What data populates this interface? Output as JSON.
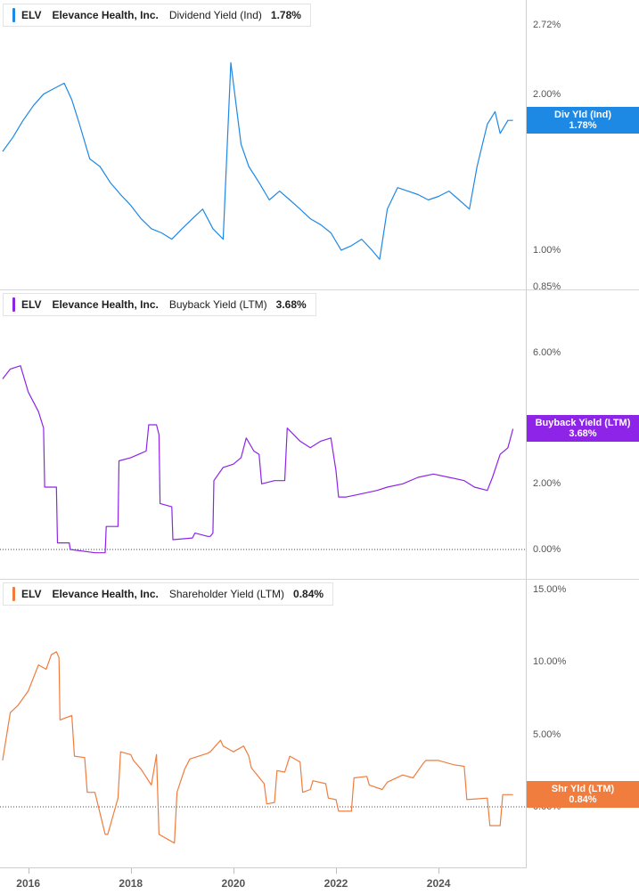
{
  "chart_data": [
    {
      "type": "line",
      "ticker": "ELV",
      "company": "Elevance Health, Inc.",
      "metric": "Dividend Yield (Ind)",
      "current_value": "1.78%",
      "tag_label": "Div Yld (Ind)",
      "tag_value": "1.78%",
      "color": "#1e88e5",
      "yscale": "log",
      "ylim": [
        0.85,
        2.72
      ],
      "yticks": [
        {
          "value": 2.72,
          "label": "2.72%"
        },
        {
          "value": 2.0,
          "label": "2.00%"
        },
        {
          "value": 1.0,
          "label": "1.00%"
        },
        {
          "value": 0.85,
          "label": "0.85%"
        }
      ],
      "series": [
        {
          "x": [
            2015.5,
            2015.7,
            2015.9,
            2016.1,
            2016.3,
            2016.5,
            2016.7,
            2016.85,
            2017.0,
            2017.2,
            2017.4,
            2017.6,
            2017.8,
            2018.0,
            2018.2,
            2018.4,
            2018.6,
            2018.8,
            2019.0,
            2019.2,
            2019.4,
            2019.6,
            2019.8,
            2019.95,
            2020.15,
            2020.3,
            2020.5,
            2020.7,
            2020.9,
            2021.1,
            2021.3,
            2021.5,
            2021.7,
            2021.9,
            2022.1,
            2022.3,
            2022.5,
            2022.7,
            2022.85,
            2023.0,
            2023.2,
            2023.4,
            2023.6,
            2023.8,
            2024.0,
            2024.2,
            2024.4,
            2024.6,
            2024.75,
            2024.95,
            2025.1,
            2025.2,
            2025.35,
            2025.45
          ],
          "y": [
            1.55,
            1.65,
            1.78,
            1.9,
            2.0,
            2.05,
            2.1,
            1.95,
            1.75,
            1.5,
            1.45,
            1.35,
            1.28,
            1.22,
            1.15,
            1.1,
            1.08,
            1.05,
            1.1,
            1.15,
            1.2,
            1.1,
            1.05,
            2.3,
            1.6,
            1.45,
            1.35,
            1.25,
            1.3,
            1.25,
            1.2,
            1.15,
            1.12,
            1.08,
            1.0,
            1.02,
            1.05,
            1.0,
            0.96,
            1.2,
            1.32,
            1.3,
            1.28,
            1.25,
            1.27,
            1.3,
            1.25,
            1.2,
            1.45,
            1.75,
            1.85,
            1.68,
            1.78,
            1.78
          ]
        }
      ]
    },
    {
      "type": "line",
      "ticker": "ELV",
      "company": "Elevance Health, Inc.",
      "metric": "Buyback Yield (LTM)",
      "current_value": "3.68%",
      "tag_label": "Buyback Yield (LTM)",
      "tag_value": "3.68%",
      "color": "#8e24e8",
      "yscale": "linear",
      "ylim": [
        0,
        6
      ],
      "yticks": [
        {
          "value": 6.0,
          "label": "6.00%"
        },
        {
          "value": 2.0,
          "label": "2.00%"
        },
        {
          "value": 0.0,
          "label": "0.00%"
        }
      ],
      "series": [
        {
          "x": [
            2015.5,
            2015.65,
            2015.85,
            2016.0,
            2016.2,
            2016.3,
            2016.32,
            2016.55,
            2016.57,
            2016.8,
            2016.82,
            2017.3,
            2017.5,
            2017.52,
            2017.75,
            2017.77,
            2018.0,
            2018.3,
            2018.35,
            2018.5,
            2018.55,
            2018.57,
            2018.8,
            2018.82,
            2019.2,
            2019.25,
            2019.5,
            2019.55,
            2019.6,
            2019.62,
            2019.8,
            2020.0,
            2020.15,
            2020.25,
            2020.4,
            2020.5,
            2020.55,
            2020.8,
            2021.0,
            2021.05,
            2021.3,
            2021.5,
            2021.7,
            2021.9,
            2022.0,
            2022.05,
            2022.2,
            2022.5,
            2022.8,
            2023.0,
            2023.3,
            2023.6,
            2023.9,
            2024.2,
            2024.5,
            2024.7,
            2024.95,
            2025.05,
            2025.2,
            2025.35,
            2025.45
          ],
          "y": [
            5.2,
            5.5,
            5.6,
            4.8,
            4.2,
            3.7,
            1.9,
            1.9,
            0.2,
            0.2,
            0.0,
            -0.1,
            -0.1,
            0.7,
            0.7,
            2.7,
            2.8,
            3.0,
            3.8,
            3.8,
            3.5,
            1.4,
            1.3,
            0.3,
            0.35,
            0.5,
            0.4,
            0.4,
            0.5,
            2.1,
            2.5,
            2.6,
            2.8,
            3.4,
            3.0,
            2.9,
            2.0,
            2.1,
            2.1,
            3.7,
            3.3,
            3.1,
            3.3,
            3.4,
            2.4,
            1.6,
            1.6,
            1.7,
            1.8,
            1.9,
            2.0,
            2.2,
            2.3,
            2.2,
            2.1,
            1.9,
            1.8,
            2.2,
            2.9,
            3.1,
            3.68
          ]
        }
      ]
    },
    {
      "type": "line",
      "ticker": "ELV",
      "company": "Elevance Health, Inc.",
      "metric": "Shareholder Yield (LTM)",
      "current_value": "0.84%",
      "tag_label": "Shr Yld (LTM)",
      "tag_value": "0.84%",
      "color": "#f07c3e",
      "yscale": "linear",
      "ylim": [
        0,
        15
      ],
      "yticks": [
        {
          "value": 15.0,
          "label": "15.00%"
        },
        {
          "value": 10.0,
          "label": "10.00%"
        },
        {
          "value": 5.0,
          "label": "5.00%"
        },
        {
          "value": 0.0,
          "label": "0.00%"
        }
      ],
      "series": [
        {
          "x": [
            2015.5,
            2015.65,
            2015.8,
            2016.0,
            2016.2,
            2016.35,
            2016.45,
            2016.55,
            2016.6,
            2016.62,
            2016.85,
            2016.9,
            2017.1,
            2017.15,
            2017.3,
            2017.5,
            2017.55,
            2017.75,
            2017.8,
            2018.0,
            2018.05,
            2018.2,
            2018.4,
            2018.5,
            2018.55,
            2018.85,
            2018.9,
            2019.05,
            2019.15,
            2019.5,
            2019.55,
            2019.75,
            2019.8,
            2020.0,
            2020.2,
            2020.3,
            2020.35,
            2020.6,
            2020.65,
            2020.8,
            2020.85,
            2021.0,
            2021.1,
            2021.3,
            2021.35,
            2021.5,
            2021.55,
            2021.8,
            2021.85,
            2022.0,
            2022.05,
            2022.3,
            2022.35,
            2022.6,
            2022.65,
            2022.9,
            2023.0,
            2023.3,
            2023.5,
            2023.7,
            2023.75,
            2024.0,
            2024.3,
            2024.5,
            2024.55,
            2024.95,
            2025.0,
            2025.2,
            2025.25,
            2025.45
          ],
          "y": [
            3.2,
            6.5,
            7.0,
            8.0,
            9.8,
            9.5,
            10.5,
            10.7,
            10.3,
            6.0,
            6.3,
            3.5,
            3.4,
            1.0,
            1.0,
            -1.9,
            -1.9,
            0.6,
            3.8,
            3.6,
            3.2,
            2.6,
            1.5,
            3.6,
            -1.9,
            -2.5,
            1.0,
            2.6,
            3.3,
            3.7,
            3.8,
            4.6,
            4.2,
            3.8,
            4.2,
            3.5,
            2.7,
            1.6,
            0.2,
            0.3,
            2.5,
            2.4,
            3.5,
            3.1,
            1.0,
            1.2,
            1.8,
            1.6,
            0.6,
            0.5,
            -0.3,
            -0.3,
            2.0,
            2.1,
            1.5,
            1.2,
            1.7,
            2.2,
            2.0,
            3.0,
            3.2,
            3.2,
            2.9,
            2.8,
            0.5,
            0.6,
            -1.3,
            -1.3,
            0.84,
            0.84
          ]
        }
      ]
    }
  ],
  "x_axis": {
    "ticks": [
      {
        "value": 2016,
        "label": "2016"
      },
      {
        "value": 2018,
        "label": "2018"
      },
      {
        "value": 2020,
        "label": "2020"
      },
      {
        "value": 2022,
        "label": "2022"
      },
      {
        "value": 2024,
        "label": "2024"
      }
    ],
    "xlim": [
      2015.45,
      2025.7
    ]
  }
}
